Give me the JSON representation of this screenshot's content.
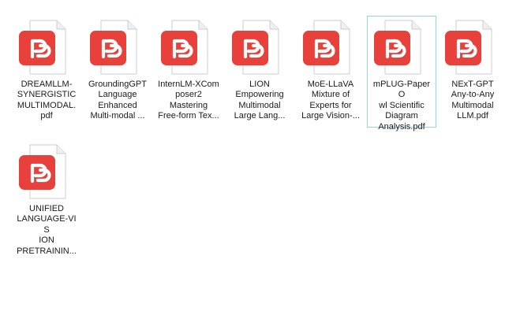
{
  "files": [
    {
      "label": "DREAMLLM-\nSYNERGISTIC\nMULTIMODAL.\npdf",
      "icon": "pdf-file-icon",
      "selected": false
    },
    {
      "label": "GroundingGPT\nLanguage\nEnhanced\nMulti-modal ...",
      "icon": "pdf-file-icon",
      "selected": false
    },
    {
      "label": "InternLM-XCom\nposer2\nMastering\nFree-form Tex...",
      "icon": "pdf-file-icon",
      "selected": false
    },
    {
      "label": "LION\nEmpowering\nMultimodal\nLarge Lang...",
      "icon": "pdf-file-icon",
      "selected": false
    },
    {
      "label": "MoE-LLaVA\nMixture of\nExperts for\nLarge Vision-...",
      "icon": "pdf-file-icon",
      "selected": false
    },
    {
      "label": "mPLUG-PaperO\nwl  Scientific\nDiagram\nAnalysis.pdf",
      "icon": "pdf-file-icon",
      "selected": true
    },
    {
      "label": "NExT-GPT\nAny-to-Any\nMultimodal\nLLM.pdf",
      "icon": "pdf-file-icon",
      "selected": false
    },
    {
      "label": "UNIFIED\nLANGUAGE-VIS\nION\nPRETRAININ...",
      "icon": "pdf-file-icon",
      "selected": false
    }
  ],
  "colors": {
    "icon_red": "#e8403a",
    "icon_red_dark": "#c93530",
    "page_bg": "#ffffff",
    "page_stroke": "#c9ccd1",
    "selection_border": "#99d1f5"
  }
}
